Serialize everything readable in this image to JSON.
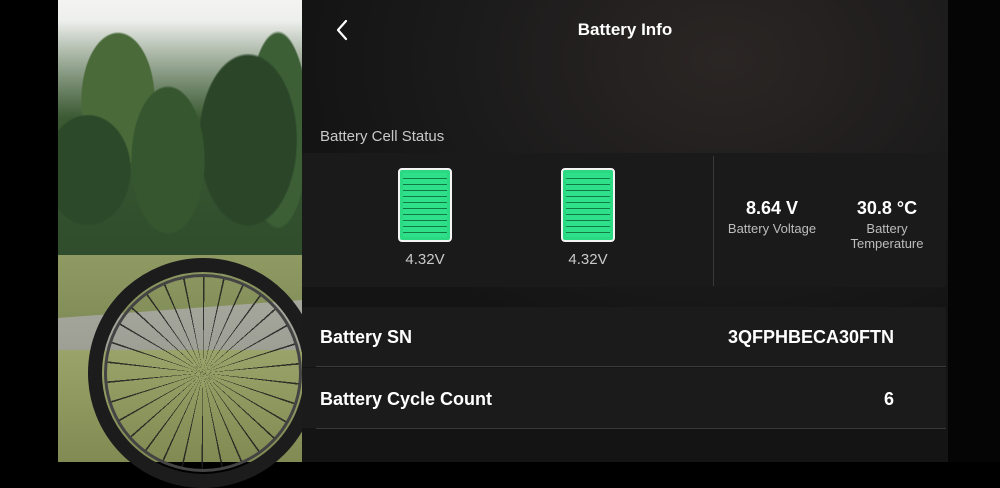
{
  "header": {
    "title": "Battery Info"
  },
  "cell_status": {
    "label": "Battery Cell Status",
    "cells": [
      {
        "voltage": "4.32V"
      },
      {
        "voltage": "4.32V"
      }
    ],
    "fill_color": "#2bd982"
  },
  "stats": {
    "voltage": {
      "value": "8.64 V",
      "label": "Battery Voltage"
    },
    "temperature": {
      "value": "30.8 °C",
      "label_line1": "Battery",
      "label_line2": "Temperature"
    }
  },
  "details": {
    "serial": {
      "label": "Battery SN",
      "value": "3QFPHBECA30FTN"
    },
    "cycles": {
      "label": "Battery Cycle Count",
      "value": "6"
    }
  }
}
